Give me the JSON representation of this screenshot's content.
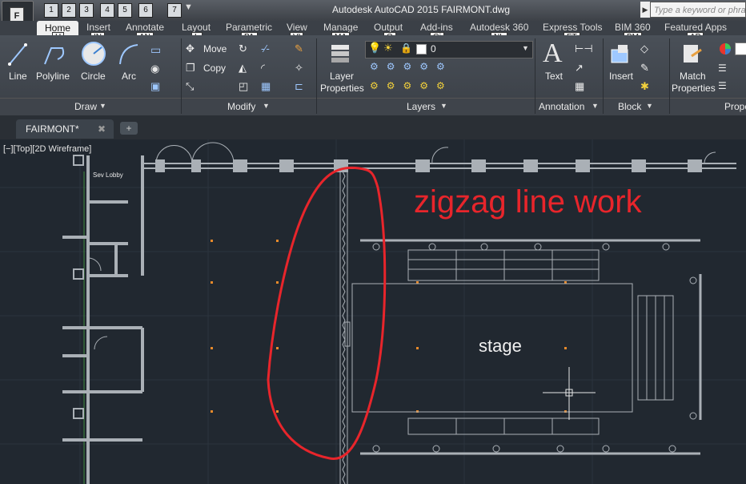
{
  "window": {
    "title": "Autodesk AutoCAD 2015    FAIRMONT.dwg",
    "search_placeholder": "Type a keyword or phrase",
    "app_button_letter": "F"
  },
  "quick_access_keys": [
    "1",
    "2",
    "3",
    "4",
    "5",
    "6",
    "7"
  ],
  "ribbon": {
    "tabs": [
      {
        "label": "Home",
        "key": "H"
      },
      {
        "label": "Insert",
        "key": "IN"
      },
      {
        "label": "Annotate",
        "key": "AN"
      },
      {
        "label": "Layout",
        "key": "L"
      },
      {
        "label": "Parametric",
        "key": "PA"
      },
      {
        "label": "View",
        "key": "VI"
      },
      {
        "label": "Manage",
        "key": "MA"
      },
      {
        "label": "Output",
        "key": "O"
      },
      {
        "label": "Add-ins",
        "key": "Gi"
      },
      {
        "label": "Autodesk 360",
        "key": "NL"
      },
      {
        "label": "Express Tools",
        "key": "ET"
      },
      {
        "label": "BIM 360",
        "key": "BM"
      },
      {
        "label": "Featured Apps",
        "key": "AP"
      }
    ],
    "draw": {
      "line": "Line",
      "polyline": "Polyline",
      "circle": "Circle",
      "arc": "Arc",
      "label": "Draw"
    },
    "modify": {
      "move": "Move",
      "copy": "Copy",
      "label": "Modify"
    },
    "layers": {
      "layer_properties_1": "Layer",
      "layer_properties_2": "Properties",
      "current_layer": "0",
      "label": "Layers"
    },
    "annotation": {
      "text": "Text",
      "label": "Annotation"
    },
    "block": {
      "insert": "Insert",
      "label": "Block"
    },
    "properties": {
      "match_1": "Match",
      "match_2": "Properties",
      "label": "Prope"
    }
  },
  "document": {
    "tab_name": "FAIRMONT*",
    "close_glyph": "✖",
    "new_tab_glyph": "+",
    "viewport_label": "[−][Top][2D Wireframe]"
  },
  "drawing": {
    "annotation_text": "zigzag line work",
    "stage_label": "stage",
    "room_label": "Sev Lobby",
    "annotation_color": "#e8252b"
  }
}
